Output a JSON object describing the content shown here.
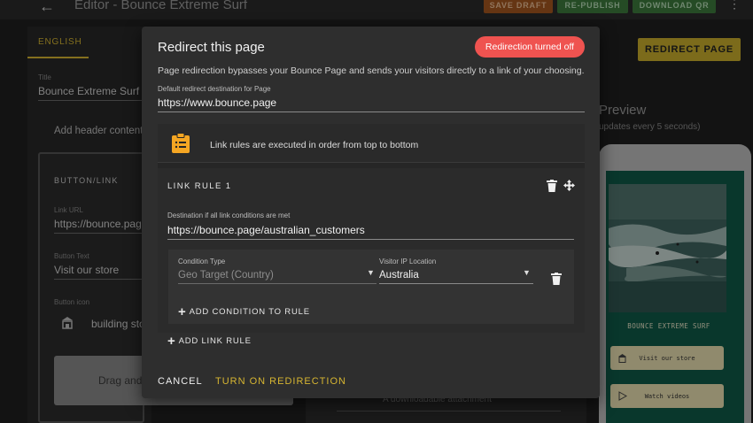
{
  "topbar": {
    "back_icon": "arrow-left-icon",
    "title": "Editor - Bounce Extreme Surf",
    "save_draft": "SAVE DRAFT",
    "republish": "RE-PUBLISH",
    "download_qr": "DOWNLOAD QR",
    "menu_icon": "more-vertical-icon"
  },
  "left": {
    "tab": "ENGLISH",
    "title_label": "Title",
    "title_value": "Bounce Extreme Surf",
    "add_header": "Add header content",
    "card_title": "BUTTON/LINK",
    "link_url_label": "Link URL",
    "link_url_value": "https://bounce.page",
    "button_text_label": "Button Text",
    "button_text_value": "Visit our store",
    "button_icon_label": "Button icon",
    "button_icon_value": "building sto",
    "drag_text": "Drag and"
  },
  "middle": {
    "attachment_text": "A downloadable attachment"
  },
  "right": {
    "redirect_page_button": "REDIRECT PAGE",
    "preview_title": "Preview",
    "preview_subtitle": "updates every 5 seconds)",
    "brand_name": "BOUNCE EXTREME SURF",
    "phone_buttons": [
      {
        "label": "Visit our store",
        "icon": "building-icon"
      },
      {
        "label": "Watch videos",
        "icon": "play-icon"
      }
    ]
  },
  "dialog": {
    "title": "Redirect this page",
    "badge": "Redirection turned off",
    "badge_color": "#ef5350",
    "description": "Page redirection bypasses your Bounce Page and sends your visitors directly to a link of your choosing.",
    "default_label": "Default redirect destination for Page",
    "default_value": "https://www.bounce.page",
    "info_text": "Link rules are executed in order from top to bottom",
    "rule": {
      "title": "LINK RULE 1",
      "dest_label": "Destination if all link conditions are met",
      "dest_value": "https://bounce.page/australian_customers",
      "condition_type_label": "Condition Type",
      "condition_type_value": "Geo Target (Country)",
      "ip_label": "Visitor IP Location",
      "ip_value": "Australia",
      "add_condition": "ADD CONDITION TO RULE"
    },
    "add_link_rule": "ADD LINK RULE",
    "cancel": "CANCEL",
    "turn_on": "TURN ON REDIRECTION",
    "accent_color": "#d6b531"
  }
}
